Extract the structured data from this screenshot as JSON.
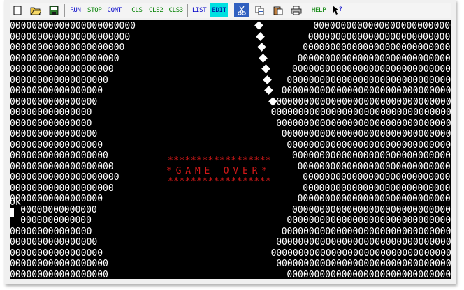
{
  "toolbar": {
    "run_label": "RUN",
    "stop_label": "STOP",
    "cont_label": "CONT",
    "cls_label": "CLS",
    "cls2_label": "CLS2",
    "cls3_label": "CLS3",
    "list_label": "LIST",
    "edit_label": "EDIT",
    "help_label": "HELP",
    "icons": [
      "new-file-icon",
      "open-folder-icon",
      "save-disk-icon",
      "cut-scissors-icon",
      "copy-icon",
      "paste-icon",
      "print-icon",
      "whats-this-help-icon"
    ]
  },
  "colors": {
    "run": "#0000c8",
    "stop": "#008000",
    "cont": "#0000c8",
    "cls": "#008000",
    "list": "#0000c8",
    "edit": "#00a0a0",
    "help": "#008000",
    "screen_bg": "#000000",
    "wall": "#ffffff",
    "game_over": "#d01818"
  },
  "game": {
    "wall_char": "0",
    "left_wall_lengths": [
      23,
      22,
      21,
      20,
      19,
      18,
      17,
      16,
      15,
      15,
      16,
      17,
      18,
      19,
      20,
      19,
      17,
      16,
      15,
      15,
      16,
      17,
      18,
      18,
      19
    ],
    "right_wall_lengths": [
      26,
      27,
      28,
      29,
      30,
      31,
      32,
      33,
      34,
      33,
      32,
      31,
      30,
      29,
      28,
      28,
      29,
      30,
      31,
      32,
      33,
      34,
      33,
      31,
      30
    ],
    "player_trail_rows": 8,
    "game_over_border": "******************",
    "game_over_text": "*GAME OVER*",
    "prompt_text": "Ok",
    "cursor": "▌"
  }
}
